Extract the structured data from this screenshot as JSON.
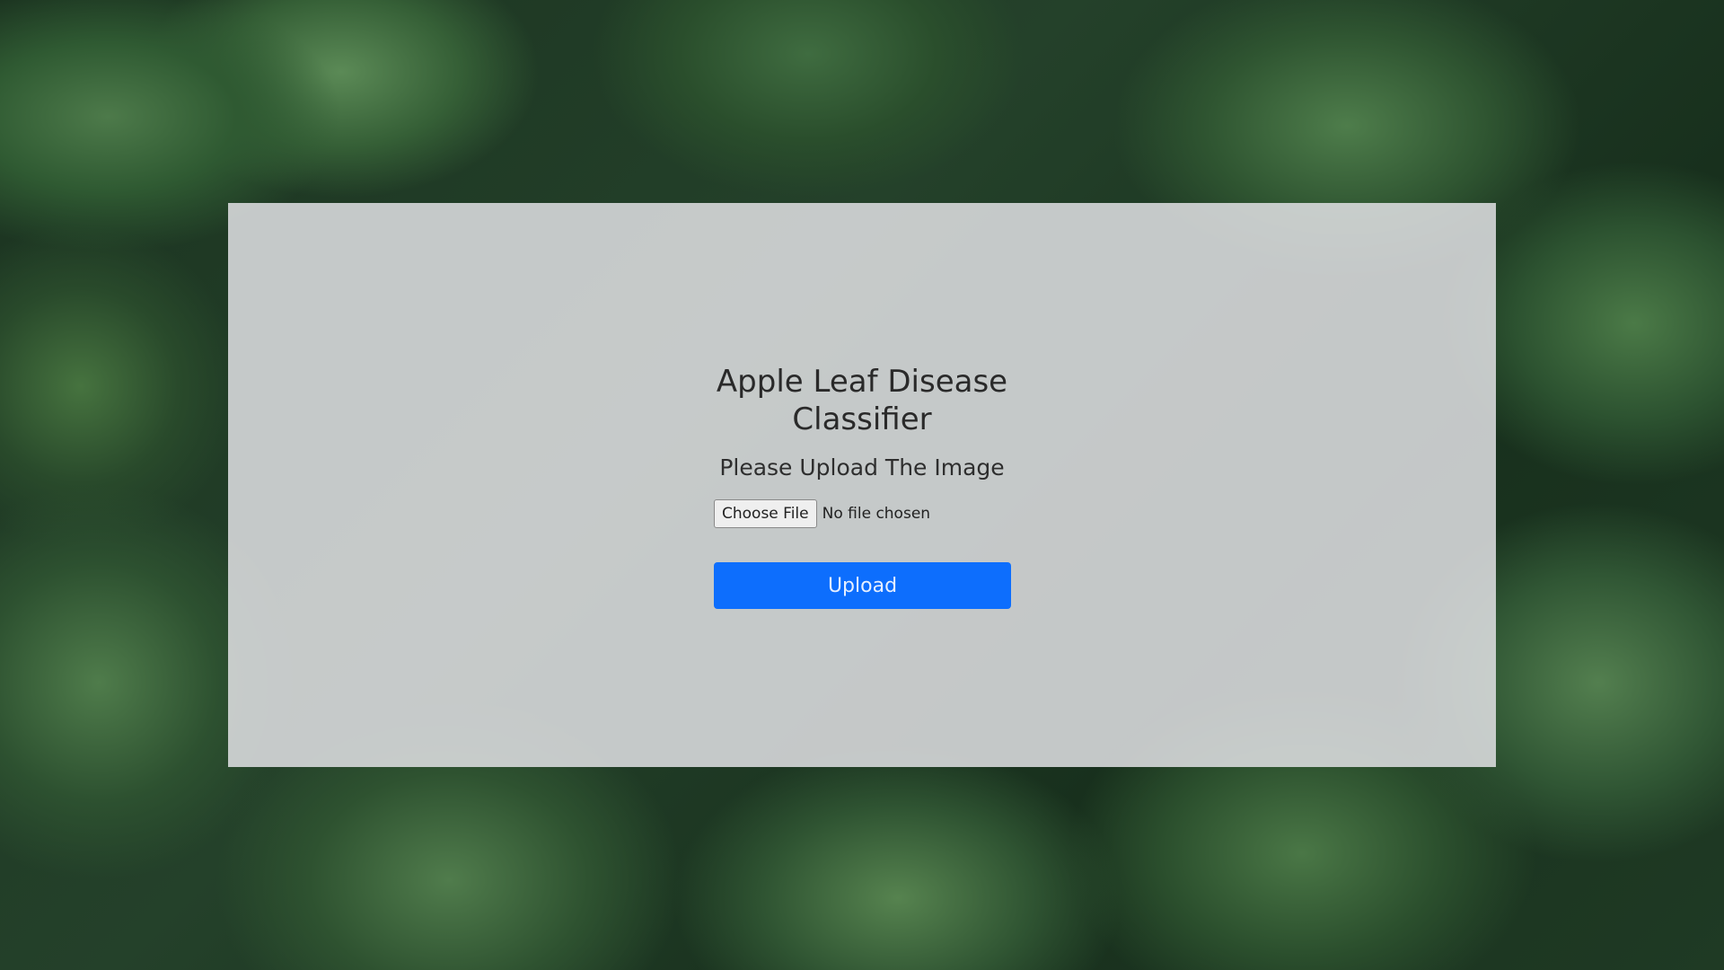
{
  "page": {
    "title_line1": "Apple Leaf Disease",
    "title_line2": "Classifier",
    "subtitle": "Please Upload The Image"
  },
  "file_input": {
    "button_label": "Choose File",
    "status_text": "No file chosen"
  },
  "upload_button": {
    "label": "Upload"
  },
  "colors": {
    "accent": "#0d6efd",
    "card_background": "#e1e1e4",
    "background": "#24412a"
  }
}
